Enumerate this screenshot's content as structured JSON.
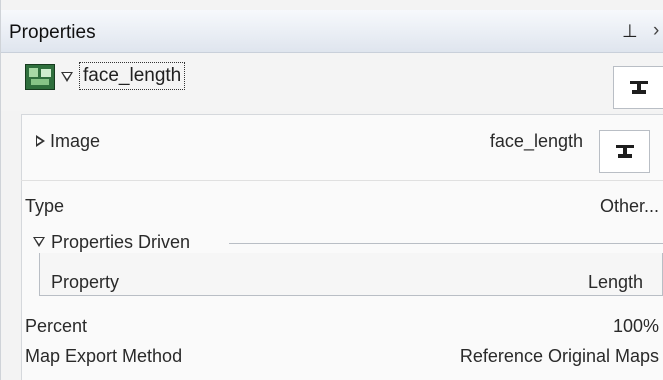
{
  "panel": {
    "title": "Properties"
  },
  "object": {
    "name": "face_length",
    "icon": "texture-map-icon"
  },
  "rows": {
    "image": {
      "label": "Image",
      "value": "face_length"
    },
    "type": {
      "label": "Type",
      "value": "Other..."
    },
    "properties_driven": {
      "label": "Properties Driven"
    },
    "property": {
      "label": "Property",
      "value": "Length"
    },
    "percent": {
      "label": "Percent",
      "value": "100%"
    },
    "map_export": {
      "label": "Map Export Method",
      "value": "Reference Original Maps"
    }
  },
  "icons": {
    "pin": "pin-icon",
    "close": "close-icon",
    "expand": "triangle-right-icon",
    "collapse": "triangle-down-icon",
    "pin_button": "pin-to-tab-icon"
  },
  "colors": {
    "titlebar": "#e4e9f0",
    "panel_bg": "#f3f3f3",
    "text": "#2a2a2a"
  }
}
